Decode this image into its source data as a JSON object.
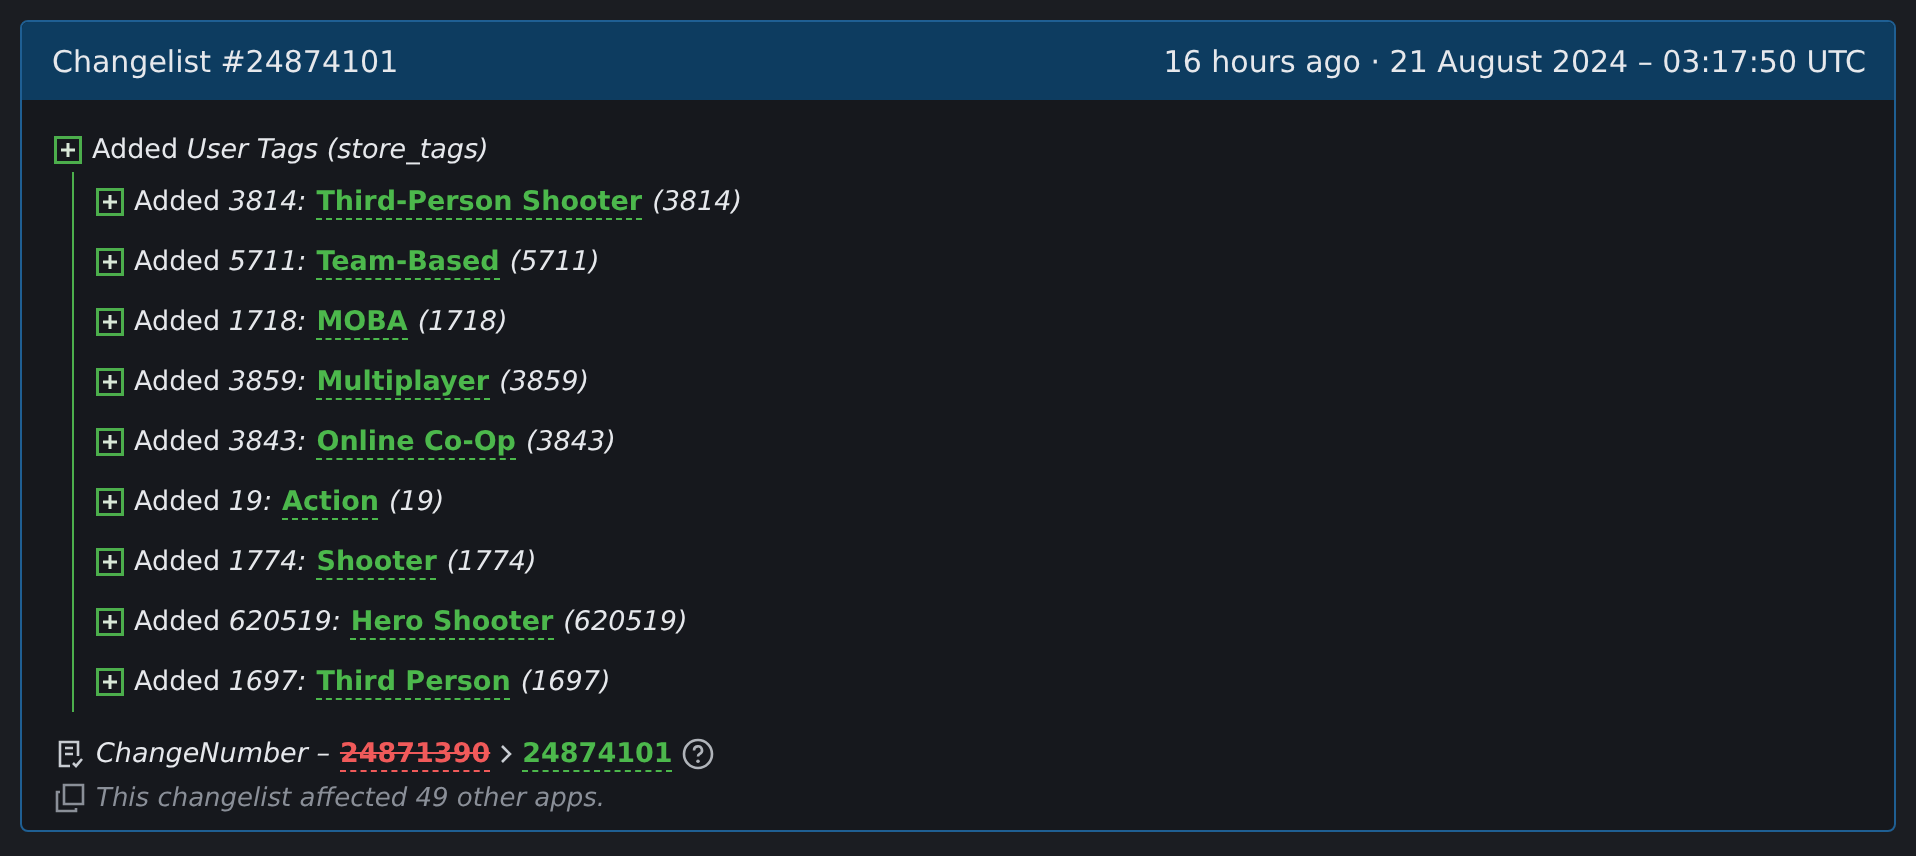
{
  "header": {
    "title": "Changelist #24874101",
    "timestamp": "16 hours ago · 21 August 2024 – 03:17:50 UTC"
  },
  "changes": [
    {
      "action": "Added",
      "subject": "User Tags (store_tags)",
      "children": [
        {
          "action": "Added",
          "id": "3814:",
          "name": "Third-Person Shooter",
          "suffix": "(3814)"
        },
        {
          "action": "Added",
          "id": "5711:",
          "name": "Team-Based",
          "suffix": "(5711)"
        },
        {
          "action": "Added",
          "id": "1718:",
          "name": "MOBA",
          "suffix": "(1718)"
        },
        {
          "action": "Added",
          "id": "3859:",
          "name": "Multiplayer",
          "suffix": "(3859)"
        },
        {
          "action": "Added",
          "id": "3843:",
          "name": "Online Co-Op",
          "suffix": "(3843)"
        },
        {
          "action": "Added",
          "id": "19:",
          "name": "Action",
          "suffix": "(19)"
        },
        {
          "action": "Added",
          "id": "1774:",
          "name": "Shooter",
          "suffix": "(1774)"
        },
        {
          "action": "Added",
          "id": "620519:",
          "name": "Hero Shooter",
          "suffix": "(620519)"
        },
        {
          "action": "Added",
          "id": "1697:",
          "name": "Third Person",
          "suffix": "(1697)"
        }
      ]
    }
  ],
  "change_number": {
    "label": "ChangeNumber –",
    "old": "24871390",
    "new": "24874101"
  },
  "note": "This changelist affected 49 other apps."
}
